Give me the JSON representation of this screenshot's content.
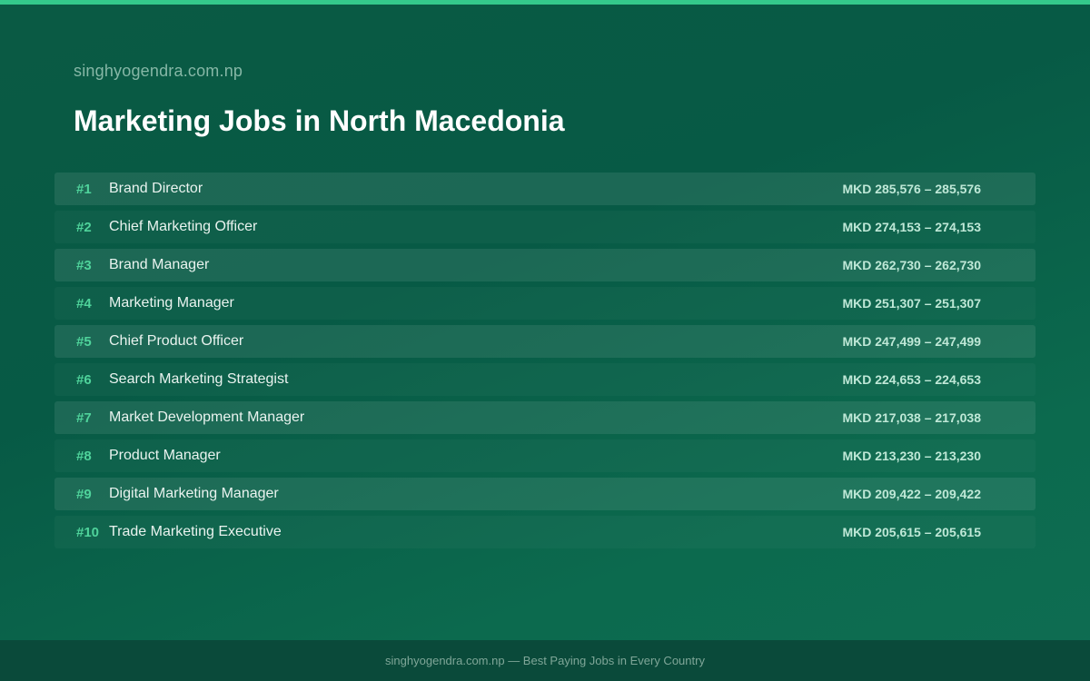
{
  "header": {
    "site": "singhyogendra.com.np",
    "title": "Marketing Jobs in North Macedonia"
  },
  "jobs": [
    {
      "rank": "#1",
      "title": "Brand Director",
      "salary": "MKD 285,576 – 285,576"
    },
    {
      "rank": "#2",
      "title": "Chief Marketing Officer",
      "salary": "MKD 274,153 – 274,153"
    },
    {
      "rank": "#3",
      "title": "Brand Manager",
      "salary": "MKD 262,730 – 262,730"
    },
    {
      "rank": "#4",
      "title": "Marketing Manager",
      "salary": "MKD 251,307 – 251,307"
    },
    {
      "rank": "#5",
      "title": "Chief Product Officer",
      "salary": "MKD 247,499 – 247,499"
    },
    {
      "rank": "#6",
      "title": "Search Marketing Strategist",
      "salary": "MKD 224,653 – 224,653"
    },
    {
      "rank": "#7",
      "title": "Market Development Manager",
      "salary": "MKD 217,038 – 217,038"
    },
    {
      "rank": "#8",
      "title": "Product Manager",
      "salary": "MKD 213,230 – 213,230"
    },
    {
      "rank": "#9",
      "title": "Digital Marketing Manager",
      "salary": "MKD 209,422 – 209,422"
    },
    {
      "rank": "#10",
      "title": "Trade Marketing Executive",
      "salary": "MKD 205,615 – 205,615"
    }
  ],
  "footer": {
    "text": "singhyogendra.com.np — Best Paying Jobs in Every Country"
  },
  "colors": {
    "accent": "#34c98b",
    "rank": "#4fd39b",
    "background": "#075a45"
  }
}
